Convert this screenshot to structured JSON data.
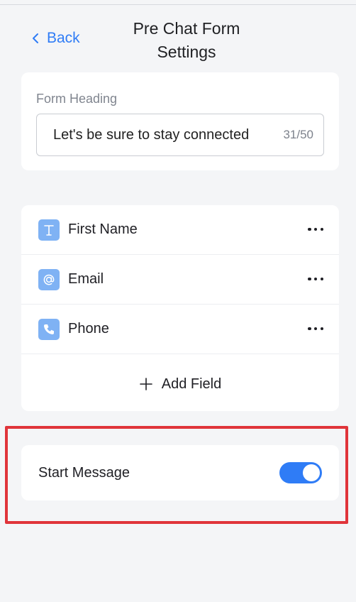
{
  "header": {
    "back_label": "Back",
    "title_line1": "Pre Chat Form",
    "title_line2": "Settings"
  },
  "form_heading": {
    "label": "Form Heading",
    "value": "Let's be sure to stay connected",
    "counter": "31/50"
  },
  "fields": [
    {
      "label": "First Name",
      "icon": "text-icon"
    },
    {
      "label": "Email",
      "icon": "at-icon"
    },
    {
      "label": "Phone",
      "icon": "phone-icon"
    }
  ],
  "add_field_label": "Add Field",
  "start_message": {
    "label": "Start Message",
    "enabled": true
  },
  "colors": {
    "accent": "#2f7cf6",
    "icon_bg": "#7fb2f4",
    "highlight": "#e0343a",
    "background": "#f4f5f7"
  }
}
